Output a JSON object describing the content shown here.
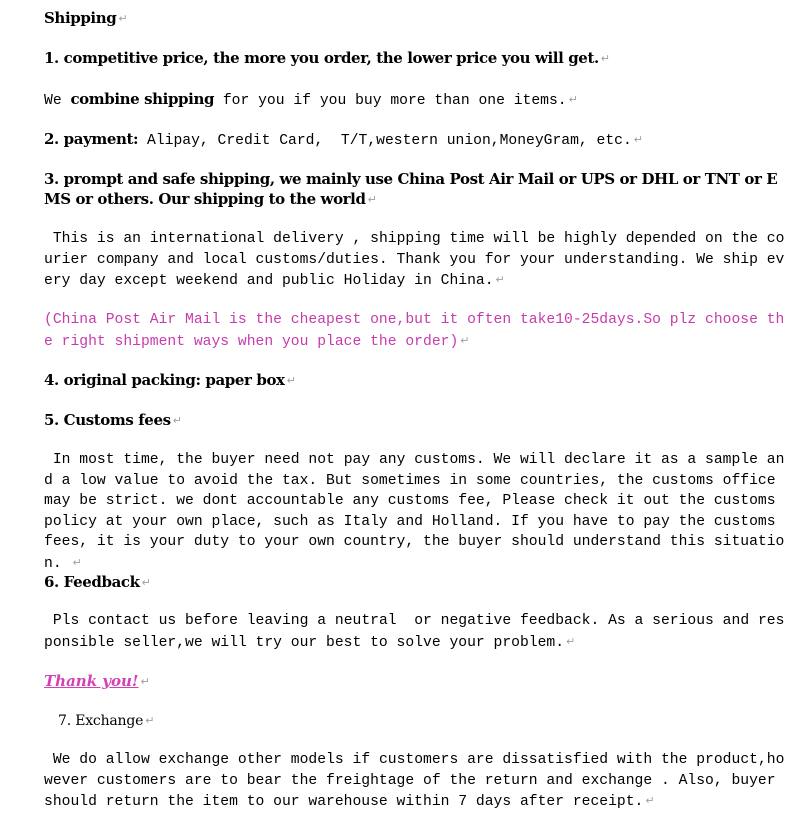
{
  "document": {
    "title": "Shipping",
    "pilcrow": "↵",
    "accent_color": "#C63CAC",
    "link_color": "#D341B5",
    "text_color": "#000000",
    "background_color": "#FFFFFF",
    "sections": [
      {
        "id": "heading-shipping",
        "kind": "heading",
        "text": "Shipping"
      },
      {
        "id": "item-1-price",
        "kind": "heading",
        "text": "1. competitive price, the more you order, the lower price you will get."
      },
      {
        "id": "para-combine-shipping",
        "kind": "paragraph-mixed",
        "lead": "We ",
        "bold": "combine shipping",
        "rest": " for you if you buy more than one items."
      },
      {
        "id": "item-2-payment",
        "kind": "heading-mixed",
        "bold": "2. payment:",
        "rest": " Alipay, Credit Card,  T/T,western union,MoneyGram, etc."
      },
      {
        "id": "item-3-shipping",
        "kind": "heading",
        "text": "3. prompt and safe shipping, we mainly use China Post Air Mail or UPS or DHL or TNT or EMS or others. Our shipping to the world"
      },
      {
        "id": "para-international-delivery",
        "kind": "paragraph",
        "text": " This is an international delivery , shipping time will be highly depended on the courier company and local customs/duties. Thank you for your understanding. We ship every day except weekend and public Holiday in China."
      },
      {
        "id": "note-china-post",
        "kind": "note",
        "text": "(China Post Air Mail is the cheapest one,but it often take10-25days.So plz choose the right shipment ways when you place the order)"
      },
      {
        "id": "item-4-packing",
        "kind": "heading",
        "text": "4. original packing: paper box"
      },
      {
        "id": "item-5-customs",
        "kind": "heading",
        "text": "5. Customs fees"
      },
      {
        "id": "para-customs",
        "kind": "paragraph",
        "text": " In most time, the buyer need not pay any customs. We will declare it as a sample and a low value to avoid the tax. But sometimes in some countries, the customs office may be strict. we dont accountable any customs fee, Please check it out the customs policy at your own place, such as Italy and Holland. If you have to pay the customs fees, it is your duty to your own country, the buyer should understand this situation. "
      },
      {
        "id": "item-6-feedback",
        "kind": "heading",
        "text": "6. Feedback"
      },
      {
        "id": "para-feedback",
        "kind": "paragraph",
        "text": " Pls contact us before leaving a neutral  or negative feedback. As a serious and responsible seller,we will try our best to solve your problem."
      },
      {
        "id": "thank-you",
        "kind": "link",
        "text": "Thank you!"
      },
      {
        "id": "item-7-exchange",
        "kind": "heading-small",
        "text": "7. Exchange"
      },
      {
        "id": "para-exchange",
        "kind": "paragraph",
        "text": " We do allow exchange other models if customers are dissatisfied with the product,however customers are to bear the freightage of the return and exchange . Also, buyer should return the item to our warehouse within 7 days after receipt."
      }
    ]
  }
}
